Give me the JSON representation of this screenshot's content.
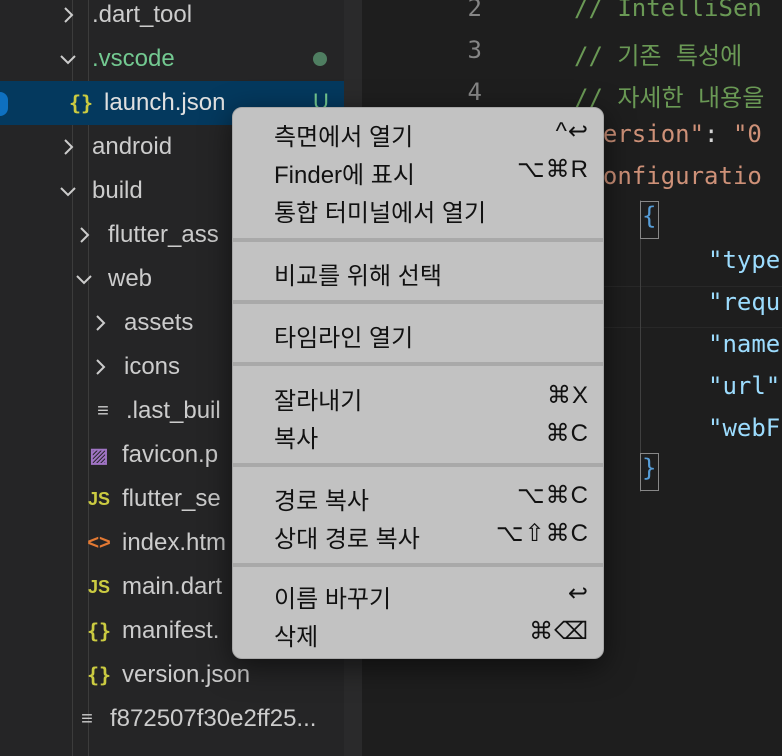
{
  "explorer": {
    "items": [
      {
        "label": ".dart_tool",
        "icon": "chevron-right-icon",
        "kind": "folder"
      },
      {
        "label": ".vscode",
        "icon": "chevron-down-icon",
        "kind": "folder"
      },
      {
        "label": "launch.json",
        "icon": "json-file-icon",
        "kind": "file",
        "badge": "U"
      },
      {
        "label": "android",
        "icon": "chevron-right-icon",
        "kind": "folder"
      },
      {
        "label": "build",
        "icon": "chevron-down-icon",
        "kind": "folder"
      },
      {
        "label": "flutter_ass",
        "icon": "chevron-right-icon",
        "kind": "folder"
      },
      {
        "label": "web",
        "icon": "chevron-down-icon",
        "kind": "folder"
      },
      {
        "label": "assets",
        "icon": "chevron-right-icon",
        "kind": "folder"
      },
      {
        "label": "icons",
        "icon": "chevron-right-icon",
        "kind": "folder"
      },
      {
        "label": ".last_buil",
        "icon": "text-file-icon",
        "kind": "file"
      },
      {
        "label": "favicon.p",
        "icon": "image-file-icon",
        "kind": "file"
      },
      {
        "label": "flutter_se",
        "icon": "js-file-icon",
        "kind": "file"
      },
      {
        "label": "index.htm",
        "icon": "html-file-icon",
        "kind": "file"
      },
      {
        "label": "main.dart",
        "icon": "js-file-icon",
        "kind": "file"
      },
      {
        "label": "manifest.",
        "icon": "json-file-icon",
        "kind": "file"
      },
      {
        "label": "version.json",
        "icon": "json-file-icon",
        "kind": "file"
      },
      {
        "label": "f872507f30e2ff25...",
        "icon": "text-file-icon",
        "kind": "file"
      }
    ],
    "icon_glyphs": {
      "json": "{}",
      "js": "JS",
      "html": "<>",
      "lines": "≡",
      "img": "▨"
    }
  },
  "editor": {
    "line_numbers": [
      "2",
      "3",
      "4"
    ],
    "lines": [
      {
        "parts": [
          {
            "t": "// IntelliSen",
            "c": "comment"
          }
        ]
      },
      {
        "parts": [
          {
            "t": "// 기존 특성에 ",
            "c": "comment"
          }
        ]
      },
      {
        "parts": [
          {
            "t": "// 자세한 내용을",
            "c": "comment"
          }
        ]
      },
      {
        "parts": [
          {
            "t": "\"version\"",
            "c": "str"
          },
          {
            "t": ": ",
            "c": "punc"
          },
          {
            "t": "\"0",
            "c": "str"
          }
        ]
      },
      {
        "parts": [
          {
            "t": "\"configuratio",
            "c": "str"
          }
        ]
      },
      {
        "parts": [
          {
            "t": "{",
            "c": "brace"
          }
        ]
      },
      {
        "parts": [
          {
            "t": "\"type",
            "c": "key"
          }
        ]
      },
      {
        "parts": [
          {
            "t": "\"requ",
            "c": "key"
          }
        ]
      },
      {
        "parts": [
          {
            "t": "\"name",
            "c": "key"
          }
        ]
      },
      {
        "parts": [
          {
            "t": "\"url\"",
            "c": "key"
          }
        ]
      },
      {
        "parts": [
          {
            "t": "\"webF",
            "c": "key"
          }
        ]
      },
      {
        "parts": [
          {
            "t": "}",
            "c": "brace"
          }
        ]
      }
    ]
  },
  "context_menu": {
    "groups": [
      [
        {
          "label": "측면에서 열기",
          "shortcut": "^↩"
        },
        {
          "label": "Finder에 표시",
          "shortcut": "⌥⌘R"
        },
        {
          "label": "통합 터미널에서 열기",
          "shortcut": ""
        }
      ],
      [
        {
          "label": "비교를 위해 선택",
          "shortcut": ""
        }
      ],
      [
        {
          "label": "타임라인 열기",
          "shortcut": ""
        }
      ],
      [
        {
          "label": "잘라내기",
          "shortcut": "⌘X"
        },
        {
          "label": "복사",
          "shortcut": "⌘C"
        }
      ],
      [
        {
          "label": "경로 복사",
          "shortcut": "⌥⌘C"
        },
        {
          "label": "상대 경로 복사",
          "shortcut": "⌥⇧⌘C"
        }
      ],
      [
        {
          "label": "이름 바꾸기",
          "shortcut": "↩"
        },
        {
          "label": "삭제",
          "shortcut": "⌘⌫"
        }
      ]
    ]
  },
  "colors": {
    "sidebar_bg": "#252526",
    "editor_bg": "#1e1e1e",
    "selection_bg": "#04395e",
    "menu_bg": "#c2c2c2",
    "comment": "#6a9955",
    "string": "#ce9178",
    "key": "#9cdcfe",
    "git_untracked": "#73c991"
  }
}
